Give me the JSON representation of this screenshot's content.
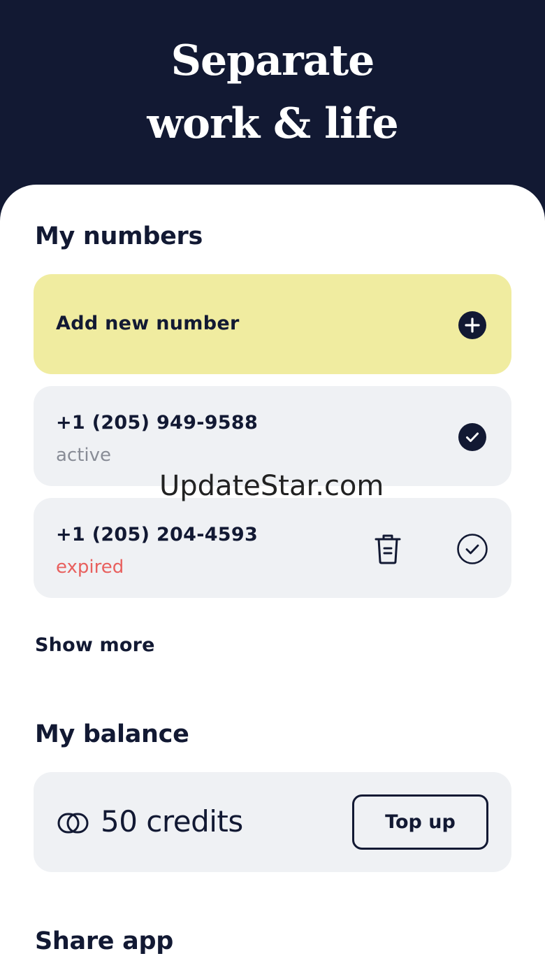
{
  "header": {
    "headline_line1": "Separate",
    "headline_line2": "work & life"
  },
  "numbers_section": {
    "title": "My numbers",
    "add_label": "Add new number",
    "items": [
      {
        "number": "+1 (205) 949-9588",
        "status": "active"
      },
      {
        "number": "+1 (205) 204-4593",
        "status": "expired"
      }
    ],
    "show_more": "Show more"
  },
  "balance_section": {
    "title": "My balance",
    "credits": "50 credits",
    "top_up_label": "Top up"
  },
  "share_section": {
    "title": "Share app"
  },
  "watermark": "UpdateStar.com",
  "colors": {
    "navy": "#121933",
    "add_card": "#f0eca0",
    "card_gray": "#eff1f4",
    "expired_red": "#e8605e",
    "status_gray": "#888c96"
  },
  "icons": {
    "add": "plus-circle-icon",
    "active": "check-circle-filled-icon",
    "delete": "trash-icon",
    "select": "check-circle-outline-icon",
    "credits": "coins-icon"
  }
}
